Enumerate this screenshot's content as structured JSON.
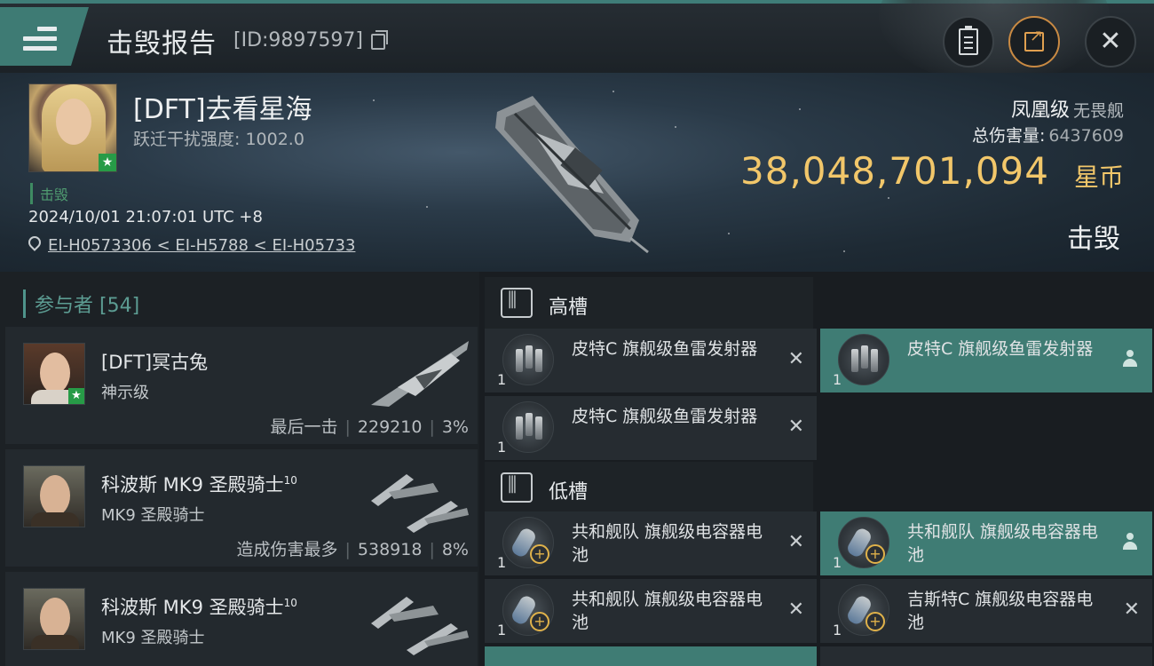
{
  "header": {
    "title": "击毁报告",
    "report_id": "[ID:9897597]"
  },
  "victim": {
    "name": "[DFT]去看星海",
    "stat_label": "跃迁干扰强度:",
    "stat_value": "1002.0",
    "outcome_tag": "击毁",
    "timestamp": "2024/10/01 21:07:01 UTC +8",
    "location": "EI-H0573306 < EI-H5788 < EI-H05733",
    "ship_name": "凤凰级",
    "ship_class": "无畏舰",
    "total_damage_label": "总伤害量:",
    "total_damage_value": "6437609",
    "isk_value": "38,048,701,094",
    "isk_unit": "星币",
    "outcome": "击毁"
  },
  "participants": {
    "title": "参与者 [54]",
    "items": [
      {
        "name": "[DFT]冥古兔",
        "level": "",
        "ship": "神示级",
        "tag": "最后一击",
        "damage": "229210",
        "percent": "3%"
      },
      {
        "name": "科波斯 MK9 圣殿骑士",
        "level": "10",
        "ship": "MK9 圣殿骑士",
        "tag": "造成伤害最多",
        "damage": "538918",
        "percent": "8%"
      },
      {
        "name": "科波斯 MK9 圣殿骑士",
        "level": "10",
        "ship": "MK9 圣殿骑士",
        "tag": "",
        "damage": "",
        "percent": ""
      }
    ]
  },
  "fittings": {
    "high_slot_title": "高槽",
    "low_slot_title": "低槽",
    "high": [
      {
        "name": "皮特C 旗舰级鱼雷发射器",
        "qty": "1",
        "status": "destroyed"
      },
      {
        "name": "皮特C 旗舰级鱼雷发射器",
        "qty": "1",
        "status": "dropped"
      },
      {
        "name": "皮特C 旗舰级鱼雷发射器",
        "qty": "1",
        "status": "destroyed"
      }
    ],
    "low": [
      {
        "name": "共和舰队 旗舰级电容器电池",
        "qty": "1",
        "status": "destroyed"
      },
      {
        "name": "共和舰队 旗舰级电容器电池",
        "qty": "1",
        "status": "dropped"
      },
      {
        "name": "共和舰队 旗舰级电容器电池",
        "qty": "1",
        "status": "destroyed"
      },
      {
        "name": "吉斯特C 旗舰级电容器电池",
        "qty": "1",
        "status": "destroyed"
      }
    ]
  },
  "colors": {
    "accent": "#3e7b74",
    "isk": "#f2c76a",
    "dropped_highlight": "#3f7c74"
  },
  "icons": {
    "destroyed": "close-icon",
    "dropped": "person-icon"
  }
}
